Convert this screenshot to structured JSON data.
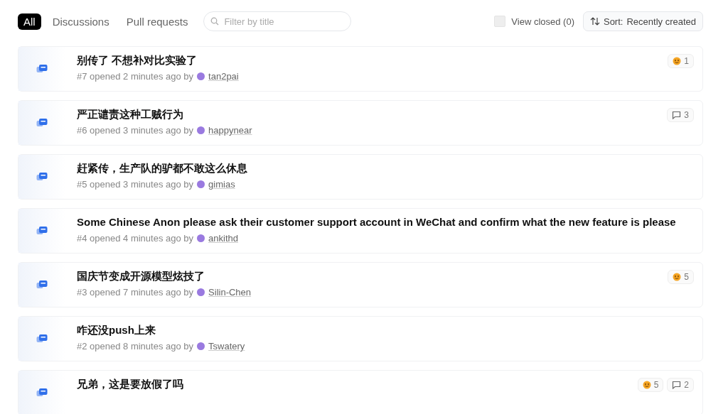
{
  "tabs": [
    {
      "label": "All",
      "selected": true
    },
    {
      "label": "Discussions",
      "selected": false
    },
    {
      "label": "Pull requests",
      "selected": false
    }
  ],
  "search": {
    "placeholder": "Filter by title"
  },
  "view_closed": {
    "label": "View closed (0)",
    "checked": false
  },
  "sort": {
    "label": "Sort:",
    "value": "Recently created"
  },
  "discussions": [
    {
      "title": "别传了 不想补对比实验了",
      "meta": "#7 opened 2 minutes ago by",
      "author": "tan2pai",
      "badges": [
        {
          "kind": "reaction",
          "count": "1"
        }
      ]
    },
    {
      "title": "严正谴责这种工贼行为",
      "meta": "#6 opened 3 minutes ago by",
      "author": "happynear",
      "badges": [
        {
          "kind": "comments",
          "count": "3"
        }
      ]
    },
    {
      "title": "赶紧传，生产队的驴都不敢这么休息",
      "meta": "#5 opened 3 minutes ago by",
      "author": "gimias"
    },
    {
      "title": "Some Chinese Anon please ask their customer support account in WeChat and confirm what the new feature is please",
      "meta": "#4 opened 4 minutes ago by",
      "author": "ankithd"
    },
    {
      "title": "国庆节变成开源模型炫技了",
      "meta": "#3 opened 7 minutes ago by",
      "author": "Silin-Chen",
      "badges": [
        {
          "kind": "reaction",
          "count": "5"
        }
      ]
    },
    {
      "title": "咋还没push上来",
      "meta": "#2 opened 8 minutes ago by",
      "author": "Tswatery"
    },
    {
      "title": "兄弟，这是要放假了吗",
      "badges": [
        {
          "kind": "reaction",
          "count": "5"
        },
        {
          "kind": "comments",
          "count": "2"
        }
      ]
    }
  ]
}
